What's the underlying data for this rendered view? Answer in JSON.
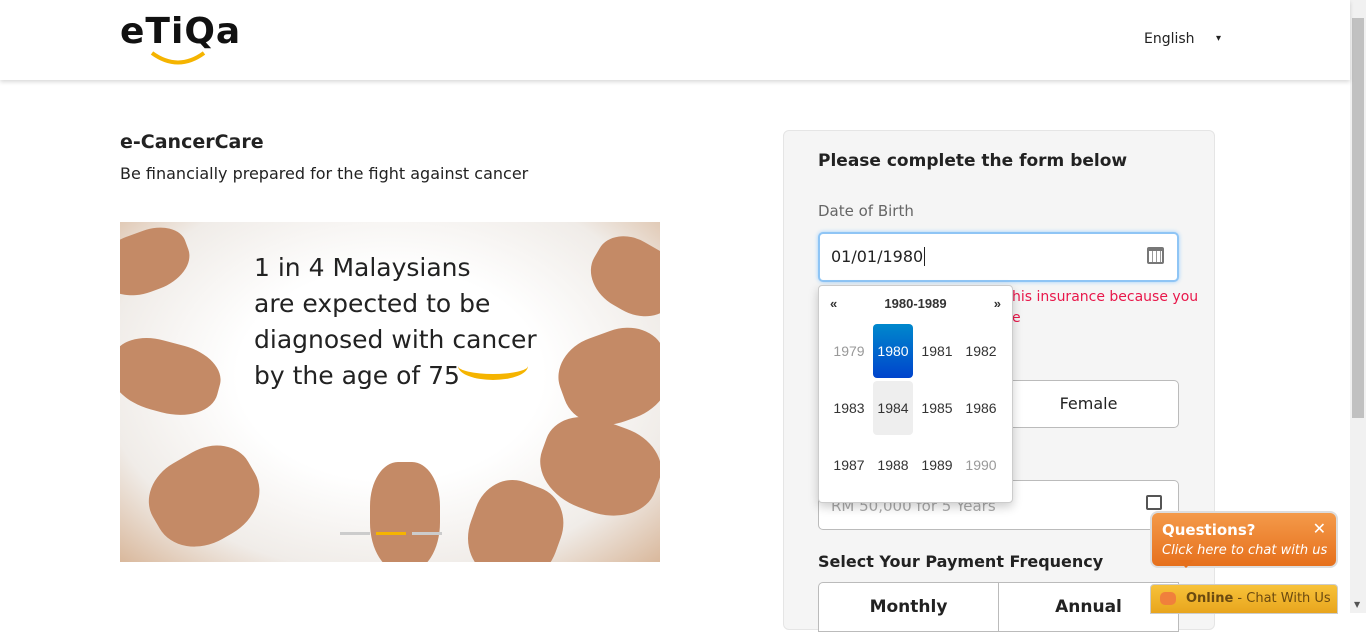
{
  "header": {
    "logo_text": "eTiQa",
    "language": "English",
    "language_caret": "▾"
  },
  "hero": {
    "title": "e-CancerCare",
    "subtitle": "Be financially prepared for the fight against cancer",
    "banner_lines": [
      "1 in 4 Malaysians",
      "are expected to be",
      "diagnosed with cancer",
      "by the age of 75"
    ],
    "slide_count": 3,
    "active_slide": 2
  },
  "form": {
    "title": "Please complete the form below",
    "dob_label": "Date of Birth",
    "dob_value": "01/01/1980",
    "error_line1": "his insurance because you",
    "error_line2": "e",
    "gender_female": "Female",
    "coverage_placeholder": "RM 50,000 for 5 Years",
    "payment_label": "Select Your Payment Frequency",
    "payment_options": [
      "Monthly",
      "Annual"
    ]
  },
  "datepicker": {
    "prev": "«",
    "range": "1980-1989",
    "next": "»",
    "years": [
      {
        "y": "1979",
        "s": "old"
      },
      {
        "y": "1980",
        "s": "active"
      },
      {
        "y": "1981",
        "s": ""
      },
      {
        "y": "1982",
        "s": ""
      },
      {
        "y": "1983",
        "s": ""
      },
      {
        "y": "1984",
        "s": "hover"
      },
      {
        "y": "1985",
        "s": ""
      },
      {
        "y": "1986",
        "s": ""
      },
      {
        "y": "1987",
        "s": ""
      },
      {
        "y": "1988",
        "s": ""
      },
      {
        "y": "1989",
        "s": ""
      },
      {
        "y": "1990",
        "s": "old"
      }
    ]
  },
  "chat": {
    "question": "Questions?",
    "sub": "Click here to chat with us",
    "close": "✕",
    "status": "Online",
    "cta": " - Chat With Us"
  },
  "colors": {
    "accent": "#f5b400",
    "error": "#e8174a",
    "chat": "#e6701c"
  }
}
